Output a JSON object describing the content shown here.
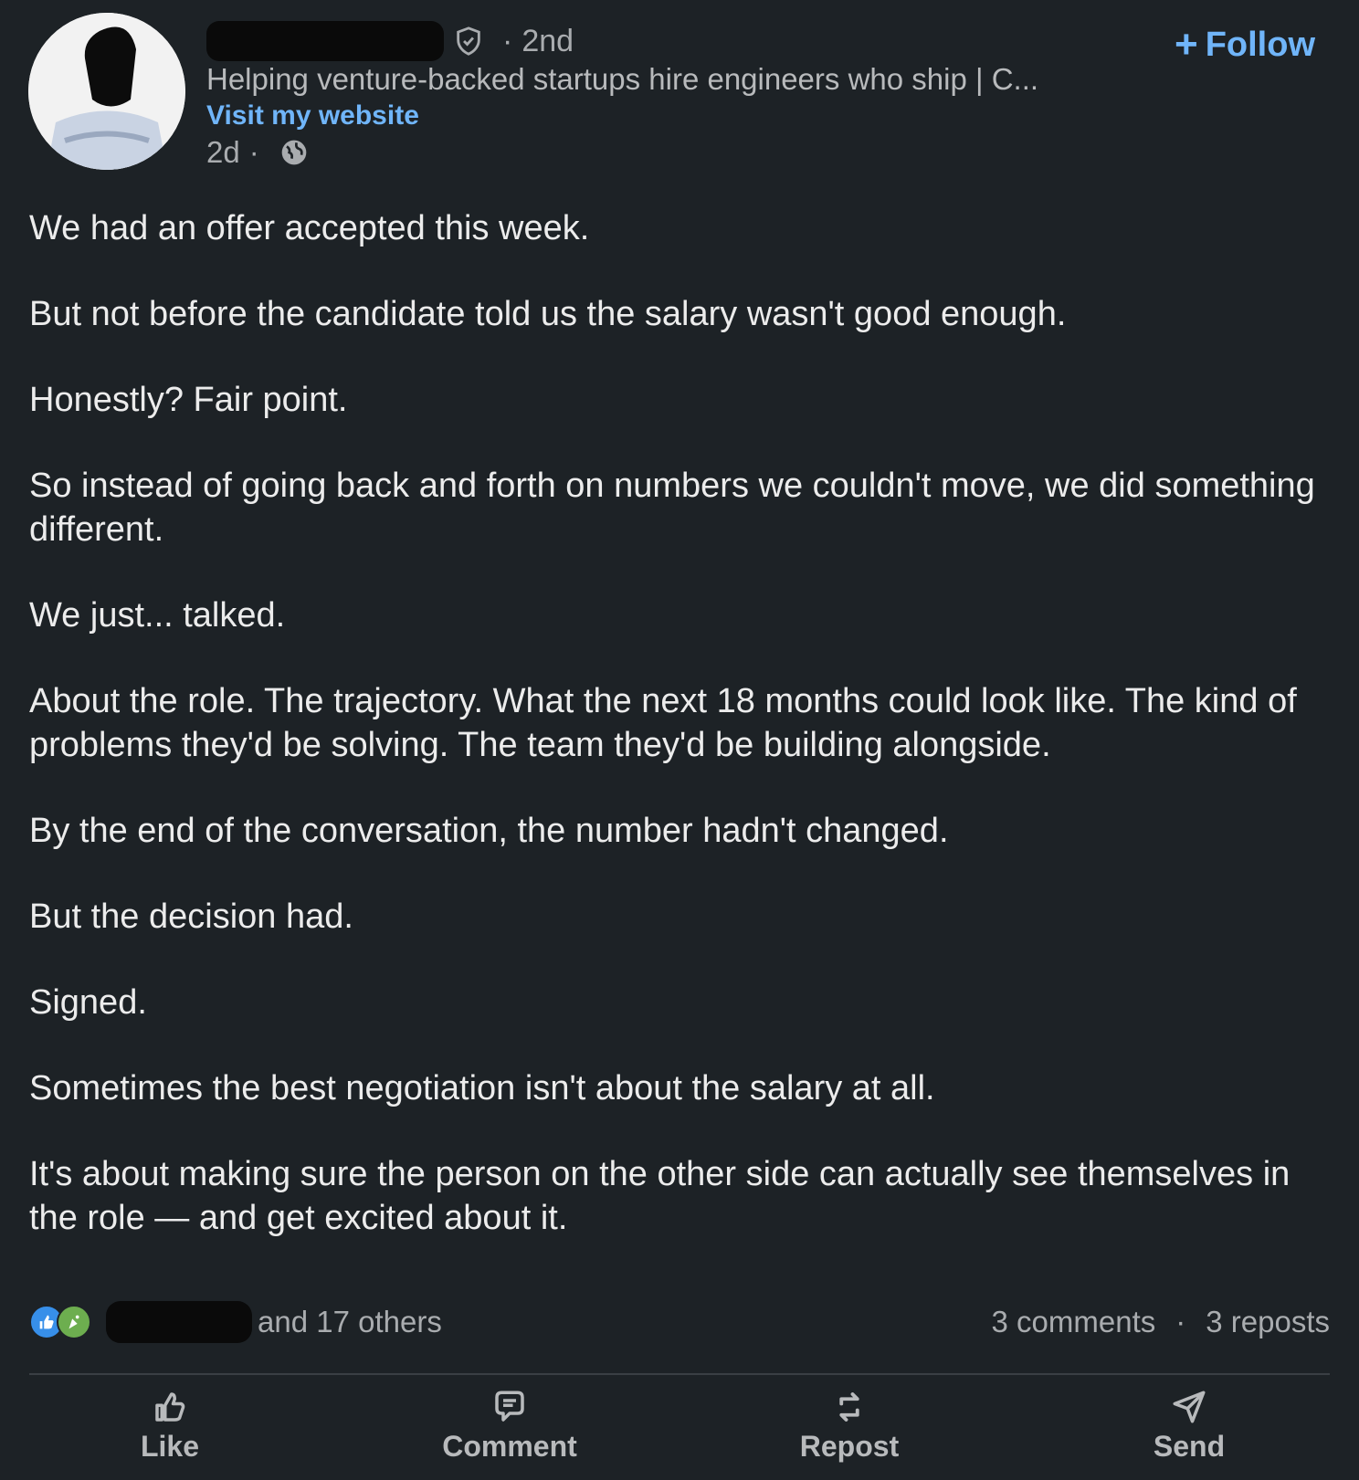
{
  "post": {
    "author": {
      "degree": "2nd",
      "headline": "Helping venture-backed startups hire engineers who ship | C...",
      "website_link": "Visit my website",
      "time_ago": "2d"
    },
    "follow_label": "Follow",
    "body": [
      "We had an offer accepted this week.",
      "But not before the candidate told us the salary wasn't good enough.",
      "Honestly? Fair point.",
      "So instead of going back and forth on numbers we couldn't move, we did something different.",
      "We just... talked.",
      "About the role. The trajectory. What the next 18 months could look like. The kind of problems they'd be solving. The team they'd be building alongside.",
      "By the end of the conversation, the number hadn't changed.",
      "But the decision had.",
      "Signed.",
      "Sometimes the best negotiation isn't about the salary at all.",
      "It's about making sure the person on the other side can actually see themselves in the role — and get excited about it."
    ],
    "reactions": {
      "others_text": "and 17 others",
      "comments": "3 comments",
      "reposts": "3 reposts"
    },
    "actions": {
      "like": "Like",
      "comment": "Comment",
      "repost": "Repost",
      "send": "Send"
    }
  },
  "colors": {
    "background": "#1d2226",
    "link_blue": "#70b5f9",
    "text_primary": "#ececec",
    "text_secondary": "#a9acaf"
  }
}
